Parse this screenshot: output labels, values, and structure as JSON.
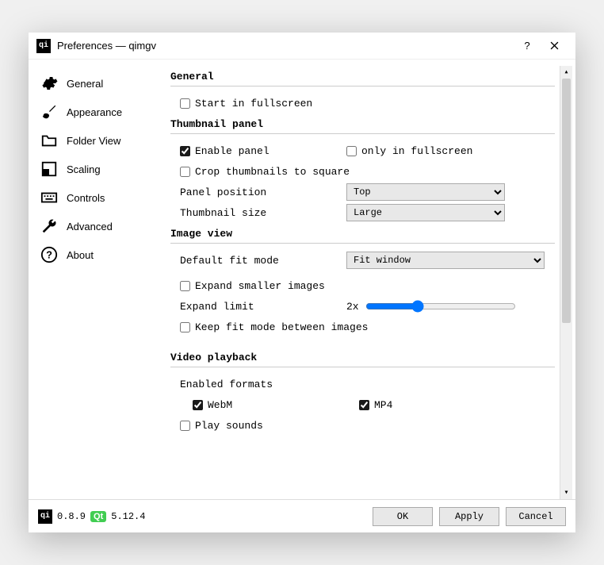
{
  "window": {
    "title": "Preferences — qimgv"
  },
  "sidebar": {
    "items": [
      {
        "label": "General"
      },
      {
        "label": "Appearance"
      },
      {
        "label": "Folder View"
      },
      {
        "label": "Scaling"
      },
      {
        "label": "Controls"
      },
      {
        "label": "Advanced"
      },
      {
        "label": "About"
      }
    ]
  },
  "sections": {
    "general": {
      "title": "General",
      "start_fullscreen": "Start in fullscreen"
    },
    "thumbnail": {
      "title": "Thumbnail panel",
      "enable_panel": "Enable panel",
      "only_fullscreen": "only in fullscreen",
      "crop_square": "Crop thumbnails to square",
      "panel_position_label": "Panel position",
      "panel_position_value": "Top",
      "thumb_size_label": "Thumbnail size",
      "thumb_size_value": "Large"
    },
    "imageview": {
      "title": "Image view",
      "fit_mode_label": "Default fit mode",
      "fit_mode_value": "Fit window",
      "expand_smaller": "Expand smaller images",
      "expand_limit_label": "Expand limit",
      "expand_limit_value": "2x",
      "keep_fit": "Keep fit mode between images"
    },
    "video": {
      "title": "Video playback",
      "enabled_formats": "Enabled formats",
      "webm": "WebM",
      "mp4": "MP4",
      "play_sounds": "Play sounds"
    }
  },
  "footer": {
    "app_version": "0.8.9",
    "qt_label": "Qt",
    "qt_version": "5.12.4",
    "ok": "OK",
    "apply": "Apply",
    "cancel": "Cancel"
  }
}
